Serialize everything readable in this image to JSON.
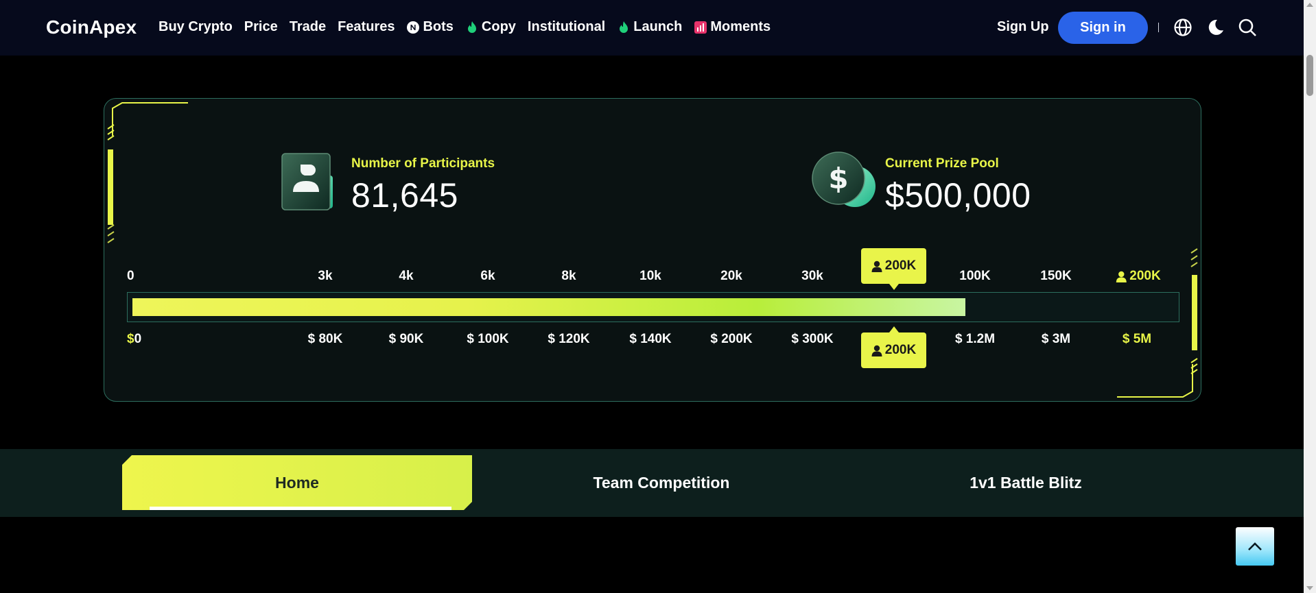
{
  "header": {
    "logo": "CoinApex",
    "nav": [
      {
        "label": "Buy Crypto",
        "icon": ""
      },
      {
        "label": "Price",
        "icon": ""
      },
      {
        "label": "Trade",
        "icon": ""
      },
      {
        "label": "Features",
        "icon": ""
      },
      {
        "label": "Bots",
        "icon": "n-badge-icon"
      },
      {
        "label": "Copy",
        "icon": "flame-icon"
      },
      {
        "label": "Institutional",
        "icon": ""
      },
      {
        "label": "Launch",
        "icon": "flame-icon"
      },
      {
        "label": "Moments",
        "icon": "chart-badge-icon"
      }
    ],
    "sign_up": "Sign Up",
    "sign_in": "Sign in",
    "separator": "|"
  },
  "stats": {
    "participants_label": "Number of Participants",
    "participants_value": "81,645",
    "prize_label": "Current Prize Pool",
    "prize_value": "$500,000"
  },
  "progress": {
    "participant_ticks": [
      "0",
      "3k",
      "4k",
      "6k",
      "8k",
      "10k",
      "20k",
      "30k",
      "100K",
      "150K",
      "200K"
    ],
    "prize_ticks": [
      "$0",
      "$ 80K",
      "$ 90K",
      "$ 100K",
      "$ 120K",
      "$ 140K",
      "$ 200K",
      "$ 300K",
      "$ 1.2M",
      "$ 3M",
      "$ 5M"
    ],
    "marker_top": "200K",
    "marker_bottom": "200K",
    "fill_fraction": 0.8
  },
  "tabs": [
    {
      "label": "Home",
      "active": true
    },
    {
      "label": "Team Competition",
      "active": false
    },
    {
      "label": "1v1 Battle Blitz",
      "active": false
    }
  ],
  "colors": {
    "accent": "#e8f548",
    "primary_button": "#2a63e8",
    "panel_border": "#2d6e5e",
    "flame": "#1fd07a"
  }
}
